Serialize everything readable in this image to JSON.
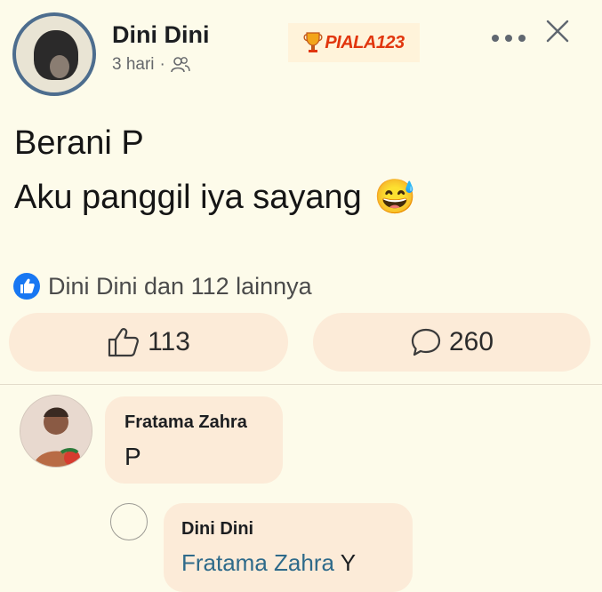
{
  "post": {
    "author": "Dini Dini",
    "time": "3 hari",
    "separator": "·",
    "privacy_icon": "friends-icon",
    "watermark": "PIALA123",
    "lines": [
      "Berani P",
      "Aku panggil iya sayang"
    ],
    "emoji": "😅",
    "reactions_text": "Dini Dini dan 112 lainnya"
  },
  "actions": {
    "like_count": "113",
    "comment_count": "260"
  },
  "comments": [
    {
      "author": "Fratama Zahra",
      "text": "P"
    }
  ],
  "replies": [
    {
      "author": "Dini Dini",
      "mention": "Fratama Zahra",
      "text": " Y"
    }
  ],
  "colors": {
    "background": "#fdfbea",
    "bubble": "#fcebd8",
    "like_blue": "#1877f2",
    "mention": "#2e6a8a",
    "logo_red": "#e1360e"
  }
}
